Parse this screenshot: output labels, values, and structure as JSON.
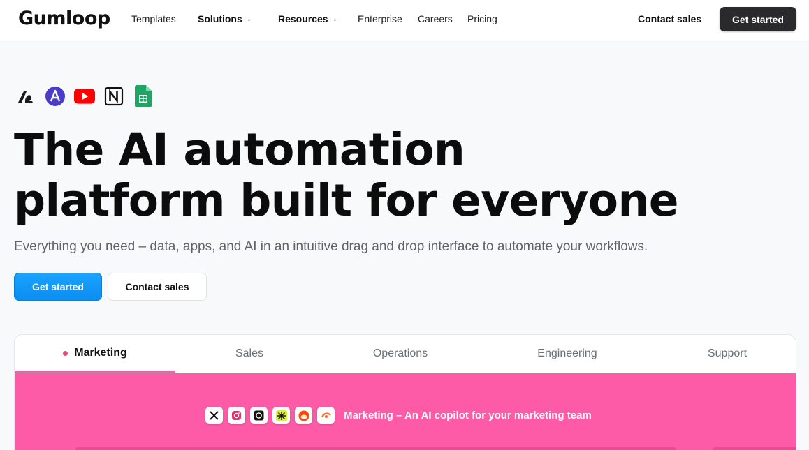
{
  "brand": {
    "name": "Gumloop"
  },
  "nav": {
    "links": [
      {
        "label": "Templates",
        "dropdown": false
      },
      {
        "label": "Solutions",
        "dropdown": true
      },
      {
        "label": "Resources",
        "dropdown": true
      },
      {
        "label": "Enterprise",
        "dropdown": false
      },
      {
        "label": "Careers",
        "dropdown": false
      },
      {
        "label": "Pricing",
        "dropdown": false
      }
    ],
    "contact_label": "Contact sales",
    "cta_label": "Get started"
  },
  "hero": {
    "integration_icons": [
      "airtable-icon",
      "apollo-icon",
      "youtube-icon",
      "notion-icon",
      "google-sheets-icon"
    ],
    "headline_line1": "The AI automation",
    "headline_line2": "platform built for everyone",
    "subheadline": "Everything you need – data, apps, and AI in an intuitive drag and drop interface to automate your workflows.",
    "primary_button": "Get started",
    "secondary_button": "Contact sales"
  },
  "tabs": {
    "items": [
      "Marketing",
      "Sales",
      "Operations",
      "Engineering",
      "Support"
    ],
    "active_index": 0
  },
  "panel": {
    "icons": [
      "x-twitter-icon",
      "instagram-icon",
      "threads-icon",
      "perplexity-icon",
      "reddit-icon",
      "semrush-icon"
    ],
    "title": "Marketing – An AI copilot for your marketing team",
    "background_color": "#fd5aa7"
  },
  "colors": {
    "primary": "#0a8ef0",
    "dark_button": "#2a2a2c",
    "accent_pink": "#fd5aa7"
  }
}
